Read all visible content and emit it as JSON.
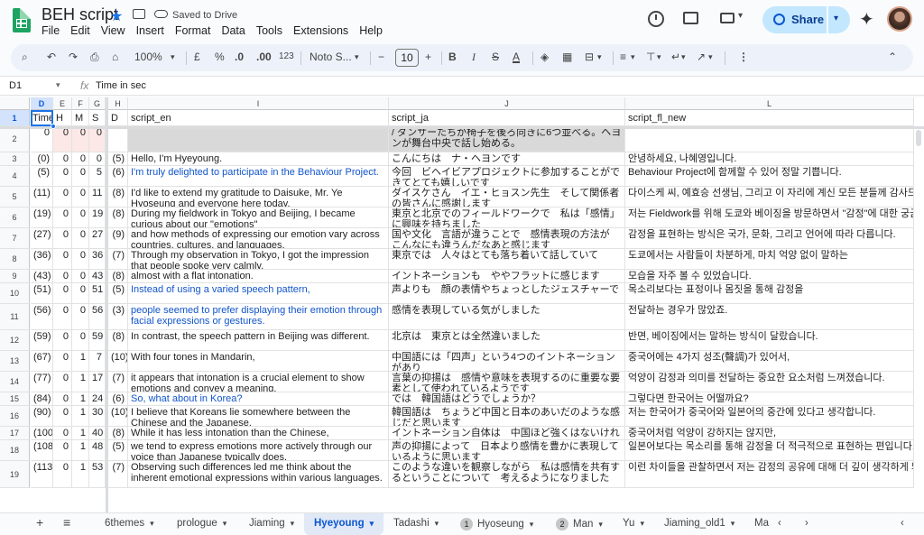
{
  "app": {
    "title": "BEH script",
    "saved_status": "Saved to Drive",
    "menus": [
      "File",
      "Edit",
      "View",
      "Insert",
      "Format",
      "Data",
      "Tools",
      "Extensions",
      "Help"
    ],
    "share_label": "Share"
  },
  "toolbar": {
    "zoom": "100%",
    "currency": "£",
    "percent": "%",
    "dec_decrease": ".0",
    "dec_increase": ".00",
    "number_format": "123",
    "font": "Noto S...",
    "minus": "−",
    "font_size": "10",
    "plus": "+",
    "bold": "B",
    "italic": "I",
    "strike": "S",
    "text_color": "A",
    "more": "⋮",
    "collapse": "⌃"
  },
  "formula_bar": {
    "cell_ref": "D1",
    "fx": "fx",
    "value": "Time in sec"
  },
  "columns": [
    "D",
    "E",
    "F",
    "G",
    "H",
    "I",
    "J",
    "L"
  ],
  "header_row": {
    "row_num": "1",
    "D": "Time",
    "E": "H",
    "F": "M",
    "G": "S",
    "H": "D",
    "I": "script_en",
    "J": "script_ja",
    "L": "script_fl_new"
  },
  "rows": [
    {
      "n": "2",
      "D": "0",
      "E": "0",
      "F": "0",
      "G": "0",
      "H": "",
      "I": "",
      "J": "/ ダンサーたちが椅子を後ろ向きに6つ並べる。ヘヨンが舞台中央で話し始める。",
      "L": ""
    },
    {
      "n": "3",
      "D": "(0)",
      "E": "0",
      "F": "0",
      "G": "0",
      "H": "(5)",
      "I": "Hello, I'm Hyeyoung.",
      "J": "こんにちは　ナ・ヘヨンです",
      "L": "안녕하세요, 나혜영입니다."
    },
    {
      "n": "4",
      "D": "(5)",
      "E": "0",
      "F": "0",
      "G": "5",
      "H": "(6)",
      "I": "I'm truly delighted to participate in the Behaviour Project.",
      "J": "今回　ビヘイビアプロジェクトに参加することができてとても嬉しいです",
      "L": "Behaviour Project에 함께할 수 있어 정말 기쁩니다."
    },
    {
      "n": "5",
      "D": "(11)",
      "E": "0",
      "F": "0",
      "G": "11",
      "H": "(8)",
      "I": "I'd like to extend my gratitude to Daisuke, Mr. Ye Hyoseung and everyone here today.",
      "J": "ダイスケさん　イエ・ヒョスン先生　そして関係者の皆さんに感謝します",
      "L": "다이스케 씨, 예효승 선생님, 그리고 이 자리에 계신 모든 분들께 감사드립니다."
    },
    {
      "n": "6",
      "D": "(19)",
      "E": "0",
      "F": "0",
      "G": "19",
      "H": "(8)",
      "I": "During my fieldwork in Tokyo and Beijing, I became curious about our \"emotions\"",
      "J": "東京と北京でのフィールドワークで　私は「感情」に興味を持ちました",
      "L": "저는 Fieldwork를 위해 도쿄와 베이징을 방문하면서 \"감정\"에 대한 궁금증이 생겼습니다."
    },
    {
      "n": "7",
      "D": "(27)",
      "E": "0",
      "F": "0",
      "G": "27",
      "H": "(9)",
      "I": "and how methods of expressing our emotion vary across countries, cultures, and languages.",
      "J": "国や文化　言語が違うことで　感情表現の方法が　こんなにも違うんだなあと感じます",
      "L": "감정을 표현하는 방식은 국가, 문화, 그리고 언어에 따라 다릅니다."
    },
    {
      "n": "8",
      "D": "(36)",
      "E": "0",
      "F": "0",
      "G": "36",
      "H": "(7)",
      "I": "Through my observation in Tokyo, I got the impression that people spoke very calmly,",
      "J": "東京では　人々はとても落ち着いて話していて",
      "L": "도쿄에서는 사람들이 차분하게, 마치 억양 없이 말하는"
    },
    {
      "n": "9",
      "D": "(43)",
      "E": "0",
      "F": "0",
      "G": "43",
      "H": "(8)",
      "I": "almost with a flat intonation.",
      "J": "イントネーションも　ややフラットに感じます",
      "L": "모습을 자주 볼 수 있었습니다."
    },
    {
      "n": "10",
      "D": "(51)",
      "E": "0",
      "F": "0",
      "G": "51",
      "H": "(5)",
      "I": "Instead of using a varied speech pattern,",
      "J": "声よりも　顔の表情やちょっとしたジェスチャーで",
      "L": "목소리보다는 표정이나 몸짓을 통해 감정을"
    },
    {
      "n": "11",
      "D": "(56)",
      "E": "0",
      "F": "0",
      "G": "56",
      "H": "(3)",
      "I": "people seemed to prefer displaying their emotion through facial expressions or gestures.",
      "J": "感情を表現している気がしました",
      "L": "전달하는 경우가 많았죠."
    },
    {
      "n": "12",
      "D": "(59)",
      "E": "0",
      "F": "0",
      "G": "59",
      "H": "(8)",
      "I": "In contrast, the speech pattern in Beijing was different.",
      "J": "北京は　東京とは全然違いました",
      "L": "반면, 베이징에서는 말하는 방식이 달랐습니다."
    },
    {
      "n": "13",
      "D": "(67)",
      "E": "0",
      "F": "1",
      "G": "7",
      "H": "(10)",
      "I": "With four tones in Mandarin,",
      "J": "中国語には「四声」という4つのイントネーションがあり",
      "L": "중국어에는 4가지 성조(聲調)가 있어서,"
    },
    {
      "n": "14",
      "D": "(77)",
      "E": "0",
      "F": "1",
      "G": "17",
      "H": "(7)",
      "I": "it appears that intonation is a crucial element to show emotions and convey a meaning.",
      "J": "言葉の抑揚は　感情や意味を表現するのに重要な要素として使われているようです",
      "L": "억양이 감정과 의미를 전달하는 중요한 요소처럼 느껴졌습니다."
    },
    {
      "n": "15",
      "D": "(84)",
      "E": "0",
      "F": "1",
      "G": "24",
      "H": "(6)",
      "I": "So, what about in Korea?",
      "J": "では　韓国語はどうでしょうか？",
      "L": "그렇다면 한국어는 어떨까요?"
    },
    {
      "n": "16",
      "D": "(90)",
      "E": "0",
      "F": "1",
      "G": "30",
      "H": "(10)",
      "I": "I believe that Koreans lie somewhere between the Chinese and the Japanese.",
      "J": "韓国語は　ちょうど中国と日本のあいだのような感じだと思います",
      "L": "저는 한국어가 중국어와 일본어의 중간에 있다고 생각합니다."
    },
    {
      "n": "17",
      "D": "(100)",
      "E": "0",
      "F": "1",
      "G": "40",
      "H": "(8)",
      "I": "While it has less intonation than the Chinese,",
      "J": "イントネーション自体は　中国ほど強くはないけれど",
      "L": "중국어처럼 억양이 강하지는 않지만,"
    },
    {
      "n": "18",
      "D": "(108)",
      "E": "0",
      "F": "1",
      "G": "48",
      "H": "(5)",
      "I": "we tend to express emotions more actively through our voice than Japanese typically does.",
      "J": "声の抑揚によって　日本より感情を豊かに表現しているように思います",
      "L": "일본어보다는 목소리를 통해 감정을 더 적극적으로 표현하는 편입니다."
    },
    {
      "n": "19",
      "D": "(113)",
      "E": "0",
      "F": "1",
      "G": "53",
      "H": "(7)",
      "I": "Observing such differences led me think about the inherent emotional expressions within various languages.",
      "J": "このような違いを観察しながら　私は感情を共有するということについて　考えるようになりました",
      "L": "이런 차이들을 관찰하면서 저는 감정의 공유에 대해 더 깊이 생각하게 되었습니다."
    }
  ],
  "sheet_tabs": {
    "add": "+",
    "all_sheets": "≡",
    "tabs": [
      {
        "label": "6themes",
        "badge": ""
      },
      {
        "label": "prologue",
        "badge": ""
      },
      {
        "label": "Jiaming",
        "badge": ""
      },
      {
        "label": "Hyeyoung",
        "badge": ""
      },
      {
        "label": "Tadashi",
        "badge": ""
      },
      {
        "label": "Hyoseung",
        "badge": "1"
      },
      {
        "label": "Man",
        "badge": "2"
      },
      {
        "label": "Yu",
        "badge": ""
      },
      {
        "label": "Jiaming_old1",
        "badge": ""
      },
      {
        "label": "Ma",
        "badge": ""
      }
    ],
    "active": "Hyeyoung"
  },
  "colors": {
    "accent": "#1a73e8",
    "link_text": "#1155cc",
    "share_bg": "#c2e7ff",
    "pink_cell": "#fce8e6",
    "gray_cell": "#d9d9d9"
  }
}
